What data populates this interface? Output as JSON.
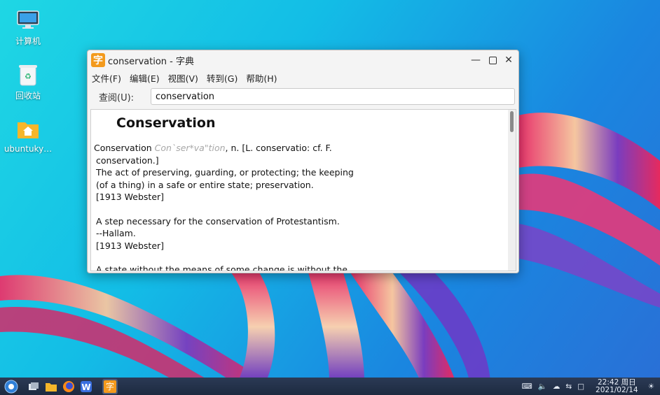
{
  "desktop": {
    "icons": [
      {
        "label": "计算机"
      },
      {
        "label": "回收站"
      },
      {
        "label": "ubuntuky…"
      }
    ]
  },
  "window": {
    "title": "conservation - 字典",
    "app_icon_char": "字",
    "menu": [
      "文件(F)",
      "编辑(E)",
      "视图(V)",
      "转到(G)",
      "帮助(H)"
    ],
    "search": {
      "label": "查阅(U):",
      "value": "conservation"
    },
    "entry": {
      "headword": "Conservation",
      "line1_word": "Conservation",
      "line1_pron": "Con`ser*va\"tion",
      "line1_rest": ", n. [L. conservatio: cf. F.",
      "line2": "conservation.]",
      "def_lines": [
        "The act of preserving, guarding, or protecting; the keeping",
        "(of a thing) in a safe or entire state; preservation.",
        "[1913 Webster]"
      ],
      "example_lines": [
        "A step necessary for the conservation of Protestantism.",
        "--Hallam.",
        "[1913 Webster]"
      ],
      "cut_line": "A state without the means of some change is without the"
    }
  },
  "taskbar": {
    "active_app_char": "字",
    "clock_time": "22:42 周日",
    "clock_date": "2021/02/14"
  },
  "colors": {
    "app_icon": "#f39a1d",
    "taskbar": "#1d2a40"
  }
}
